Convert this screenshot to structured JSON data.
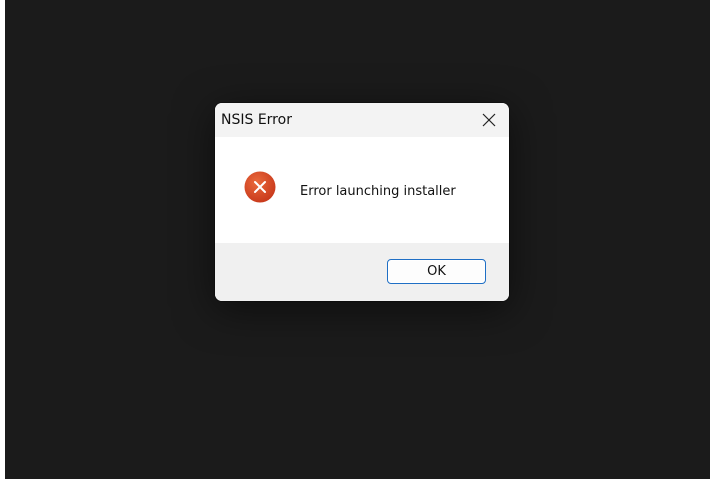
{
  "dialog": {
    "title": "NSIS Error",
    "message": "Error launching installer",
    "ok_label": "OK"
  },
  "icons": {
    "close": "close-icon",
    "error": "error-icon"
  },
  "colors": {
    "desktop_background": "#1b1b1b",
    "titlebar_background": "#f3f3f3",
    "content_background": "#ffffff",
    "footer_background": "#f0f0f0",
    "error_icon": "#d8421c",
    "button_border": "#1f6fc5"
  }
}
